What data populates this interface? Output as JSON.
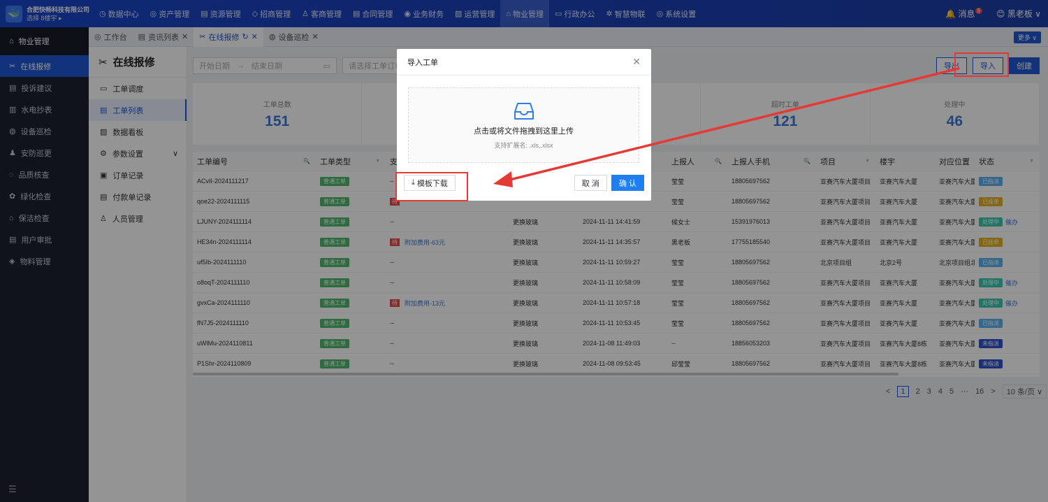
{
  "company": {
    "name": "合肥快畅科技有限公司",
    "location": "选择 8楼宇 ▸"
  },
  "topnav": [
    {
      "label": "数据中心",
      "icon": "◷"
    },
    {
      "label": "资产管理",
      "icon": "◎"
    },
    {
      "label": "资源管理",
      "icon": "▤"
    },
    {
      "label": "招商管理",
      "icon": "◇"
    },
    {
      "label": "客商管理",
      "icon": "♙"
    },
    {
      "label": "合同管理",
      "icon": "▤"
    },
    {
      "label": "业务财务",
      "icon": "◉"
    },
    {
      "label": "运营管理",
      "icon": "▨"
    },
    {
      "label": "物业管理",
      "icon": "⌂"
    },
    {
      "label": "行政办公",
      "icon": "▭"
    },
    {
      "label": "智慧物联",
      "icon": "✲"
    },
    {
      "label": "系统设置",
      "icon": "◎"
    }
  ],
  "topright": {
    "messages": "消息",
    "msg_count": "8",
    "user": "黑老板"
  },
  "sidebar": {
    "head": "物业管理",
    "items": [
      "在线报修",
      "投诉建议",
      "水电抄表",
      "设备巡检",
      "安防巡更",
      "品质核查",
      "绿化检查",
      "保洁检查",
      "用户审批",
      "物料管理"
    ]
  },
  "tabs": [
    "工作台",
    "资讯列表",
    "在线报修",
    "设备巡检"
  ],
  "more": "更多 ∨",
  "subside": {
    "title": "在线报修",
    "items": [
      "工单调度",
      "工单列表",
      "数据看板",
      "参数设置",
      "订单记录",
      "付款单记录",
      "人员管理"
    ]
  },
  "filter": {
    "start": "开始日期",
    "end": "结束日期",
    "type_ph": "请选择工单订单",
    "export": "导出",
    "import": "导入",
    "create": "创建"
  },
  "stats": [
    {
      "label": "工单总数",
      "value": "151"
    },
    {
      "label": "",
      "value": ""
    },
    {
      "label": "",
      "value": ""
    },
    {
      "label": "超时工单",
      "value": "121"
    },
    {
      "label": "处理中",
      "value": "46"
    }
  ],
  "table": {
    "headers": [
      "工单编号",
      "工单类型",
      "支",
      "",
      "",
      "上报人",
      "上报人手机",
      "项目",
      "楼宇",
      "对应位置",
      "状态"
    ],
    "rows": [
      {
        "id": "ACvII-2024111217",
        "type": "普通工单",
        "fee": "--",
        "repair": "",
        "time": "",
        "reporter": "莹莹",
        "phone": "18805697562",
        "project": "亚赛汽车大厦项目",
        "building": "亚赛汽车大厦",
        "pos": "亚赛汽车大厦",
        "status": "已指派",
        "action": ""
      },
      {
        "id": "qoe22-2024111115",
        "type": "普通工单",
        "fee": "待",
        "repair": "",
        "time": "",
        "reporter": "莹莹",
        "phone": "18805697562",
        "project": "亚赛汽车大厦项目",
        "building": "亚赛汽车大厦",
        "pos": "亚赛汽车大厦",
        "status": "已挂单",
        "action": ""
      },
      {
        "id": "LJUNY-2024111114",
        "type": "普通工单",
        "fee": "--",
        "repair": "更换玻璃",
        "time": "2024-11-11 14:41:59",
        "reporter": "候女士",
        "phone": "15391976013",
        "project": "亚赛汽车大厦项目",
        "building": "亚赛汽车大厦",
        "pos": "亚赛汽车大厦",
        "status": "处理中",
        "action": "催办"
      },
      {
        "id": "HE34n-2024111114",
        "type": "普通工单",
        "fee": "附加费用-63元",
        "repair": "更换玻璃",
        "time": "2024-11-11 14:35:57",
        "reporter": "黑老板",
        "phone": "17755185540",
        "project": "亚赛汽车大厦项目",
        "building": "亚赛汽车大厦",
        "pos": "亚赛汽车大厦",
        "status": "已挂单",
        "action": ""
      },
      {
        "id": "uf5Ib-2024111110",
        "type": "普通工单",
        "fee": "--",
        "repair": "更换玻璃",
        "time": "2024-11-11 10:59:27",
        "reporter": "莹莹",
        "phone": "18805697562",
        "project": "北京项目组",
        "building": "北京2号",
        "pos": "北京项目组北",
        "status": "已指派",
        "action": ""
      },
      {
        "id": "o8oqT-2024111110",
        "type": "普通工单",
        "fee": "--",
        "repair": "更换玻璃",
        "time": "2024-11-11 10:58:09",
        "reporter": "莹莹",
        "phone": "18805697562",
        "project": "亚赛汽车大厦项目",
        "building": "亚赛汽车大厦",
        "pos": "亚赛汽车大厦",
        "status": "处理中",
        "action": "催办"
      },
      {
        "id": "gvxCa-2024111110",
        "type": "普通工单",
        "fee": "附加费用-13元",
        "repair": "更换玻璃",
        "time": "2024-11-11 10:57:18",
        "reporter": "莹莹",
        "phone": "18805697562",
        "project": "亚赛汽车大厦项目",
        "building": "亚赛汽车大厦",
        "pos": "亚赛汽车大厦",
        "status": "处理中",
        "action": "催办"
      },
      {
        "id": "fN7J5-2024111110",
        "type": "普通工单",
        "fee": "--",
        "repair": "更换玻璃",
        "time": "2024-11-11 10:53:45",
        "reporter": "莹莹",
        "phone": "18805697562",
        "project": "亚赛汽车大厦项目",
        "building": "亚赛汽车大厦",
        "pos": "亚赛汽车大厦",
        "status": "已指派",
        "action": ""
      },
      {
        "id": "uWlMu-2024110811",
        "type": "普通工单",
        "fee": "--",
        "repair": "更换玻璃",
        "time": "2024-11-08 11:49:03",
        "reporter": "--",
        "phone": "18856053203",
        "project": "亚赛汽车大厦项目",
        "building": "亚赛汽车大厦8栋",
        "pos": "亚赛汽车大厦",
        "status": "未指派",
        "action": ""
      },
      {
        "id": "P1Shr-2024110809",
        "type": "普通工单",
        "fee": "--",
        "repair": "更换玻璃",
        "time": "2024-11-08 09:53:45",
        "reporter": "邱莹莹",
        "phone": "18805697562",
        "project": "亚赛汽车大厦项目",
        "building": "亚赛汽车大厦8栋",
        "pos": "亚赛汽车大厦",
        "status": "未指派",
        "action": ""
      }
    ]
  },
  "pager": {
    "pages": [
      "1",
      "2",
      "3",
      "4",
      "5",
      "···",
      "16"
    ],
    "size": "10 条/页 ∨"
  },
  "modal": {
    "title": "导入工单",
    "drop": "点击或将文件拖拽到这里上传",
    "hint": "支持扩展名: .xls,.xlsx",
    "template": "模板下载",
    "cancel": "取 消",
    "ok": "确 认"
  },
  "colors": {
    "brand": "#1f58d6",
    "green": "#4cba6b",
    "cyan": "#5ab1ef",
    "yellow": "#e6b022",
    "teal": "#3dc9b0",
    "navy": "#2f54c8",
    "annotation": "#e53935"
  }
}
